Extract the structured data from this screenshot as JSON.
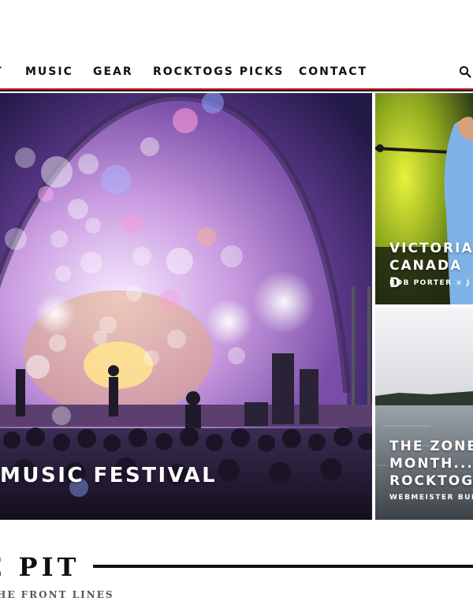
{
  "nav": {
    "items": [
      {
        "label": "T"
      },
      {
        "label": "MUSIC"
      },
      {
        "label": "GEAR"
      },
      {
        "label": "ROCKTOGS PICKS"
      },
      {
        "label": "CONTACT"
      }
    ],
    "search_icon": "search-icon",
    "accent_color": "#c0161f"
  },
  "hero": {
    "main": {
      "title": "MUSIC FESTIVAL"
    },
    "top": {
      "title": "VICTORIA\nCANADA D",
      "byline": "ROB PORTER  ×  J"
    },
    "bottom": {
      "title": "THE ZONE\nMONTH...F\nROCKTOG",
      "byline": "WEBMEISTER BUD"
    }
  },
  "section": {
    "title": "E PIT",
    "subtitle": "HE FRONT LINES"
  }
}
